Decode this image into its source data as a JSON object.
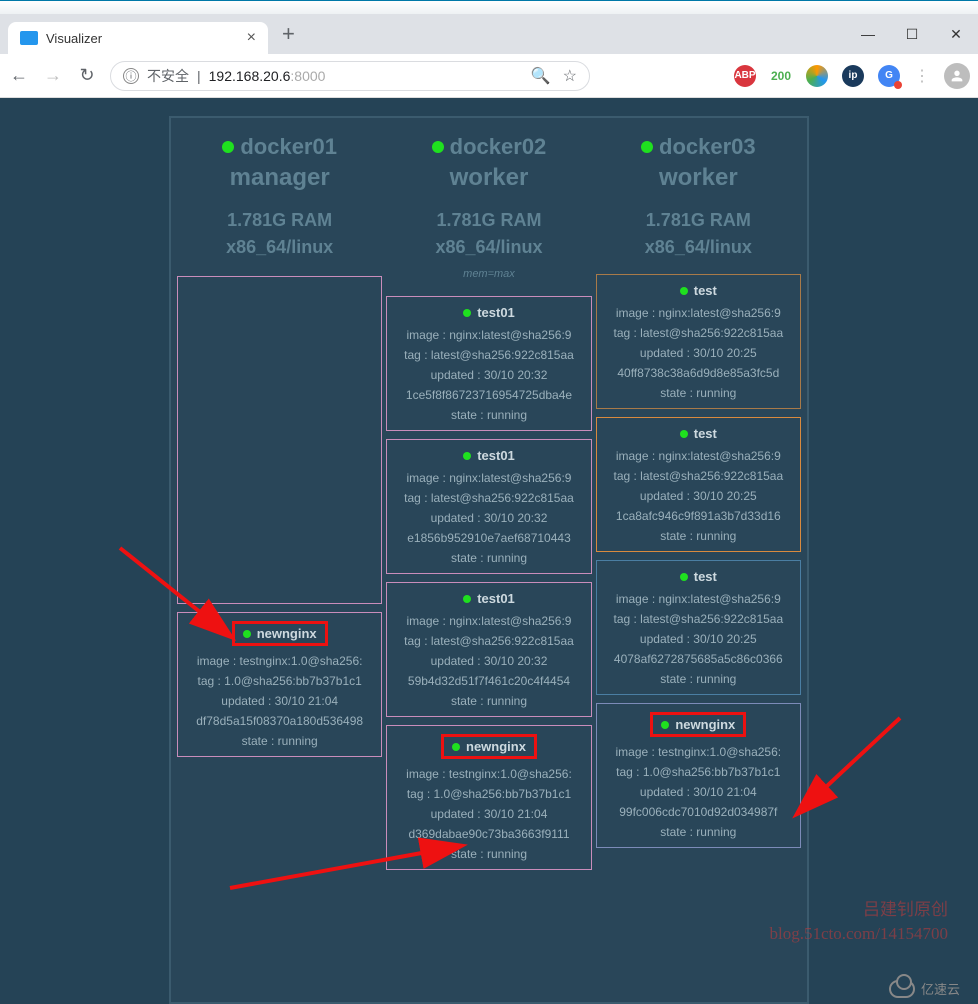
{
  "browser": {
    "tab_title": "Visualizer",
    "tab_close": "×",
    "newtab": "+",
    "win": {
      "min": "—",
      "max": "☐",
      "close": "✕"
    },
    "nav": {
      "back": "←",
      "fwd": "→",
      "reload": "↻"
    },
    "omnibox": {
      "info": "ⓘ",
      "warning": "不安全",
      "sep": "|",
      "host": "192.168.20.6",
      "port": ":8000",
      "zoom": "🔍",
      "star": "☆"
    },
    "ext": {
      "abp": "ABP",
      "c200": "200",
      "ip": "ip",
      "gt": "G"
    }
  },
  "nodes": [
    {
      "name": "docker01",
      "role": "manager",
      "ram": "1.781G RAM",
      "arch": "x86_64/linux",
      "memmax": "",
      "services": [
        {
          "blank": true,
          "tall": true,
          "cls": "outline-pink"
        },
        {
          "boxed": true,
          "cls": "outline-pink",
          "name": "newnginx",
          "image": "image : testnginx:1.0@sha256:",
          "tag": "tag : 1.0@sha256:bb7b37b1c1",
          "updated": "updated : 30/10 21:04",
          "hash": "df78d5a15f08370a180d536498",
          "state": "state : running"
        }
      ]
    },
    {
      "name": "docker02",
      "role": "worker",
      "ram": "1.781G RAM",
      "arch": "x86_64/linux",
      "memmax": "mem=max",
      "services": [
        {
          "cls": "outline-pink",
          "name": "test01",
          "image": "image : nginx:latest@sha256:9",
          "tag": "tag : latest@sha256:922c815aa",
          "updated": "updated : 30/10 20:32",
          "hash": "1ce5f8f86723716954725dba4e",
          "state": "state : running"
        },
        {
          "cls": "outline-pink",
          "name": "test01",
          "image": "image : nginx:latest@sha256:9",
          "tag": "tag : latest@sha256:922c815aa",
          "updated": "updated : 30/10 20:32",
          "hash": "e1856b952910e7aef68710443",
          "state": "state : running"
        },
        {
          "cls": "outline-pink",
          "name": "test01",
          "image": "image : nginx:latest@sha256:9",
          "tag": "tag : latest@sha256:922c815aa",
          "updated": "updated : 30/10 20:32",
          "hash": "59b4d32d51f7f461c20c4f4454",
          "state": "state : running"
        },
        {
          "boxed": true,
          "cls": "outline-pink",
          "name": "newnginx",
          "image": "image : testnginx:1.0@sha256:",
          "tag": "tag : 1.0@sha256:bb7b37b1c1",
          "updated": "updated : 30/10 21:04",
          "hash": "d369dabae90c73ba3663f9111",
          "state": "state : running"
        }
      ]
    },
    {
      "name": "docker03",
      "role": "worker",
      "ram": "1.781G RAM",
      "arch": "x86_64/linux",
      "memmax": "",
      "services": [
        {
          "cls": "outline-brown",
          "name": "test",
          "image": "image : nginx:latest@sha256:9",
          "tag": "tag : latest@sha256:922c815aa",
          "updated": "updated : 30/10 20:25",
          "hash": "40ff8738c38a6d9d8e85a3fc5d",
          "state": "state : running"
        },
        {
          "cls": "outline-orange",
          "name": "test",
          "image": "image : nginx:latest@sha256:9",
          "tag": "tag : latest@sha256:922c815aa",
          "updated": "updated : 30/10 20:25",
          "hash": "1ca8afc946c9f891a3b7d33d16",
          "state": "state : running"
        },
        {
          "cls": "outline-blue",
          "name": "test",
          "image": "image : nginx:latest@sha256:9",
          "tag": "tag : latest@sha256:922c815aa",
          "updated": "updated : 30/10 20:25",
          "hash": "4078af6272875685a5c86c0366",
          "state": "state : running"
        },
        {
          "boxed": true,
          "cls": "outline-bluep",
          "name": "newnginx",
          "image": "image : testnginx:1.0@sha256:",
          "tag": "tag : 1.0@sha256:bb7b37b1c1",
          "updated": "updated : 30/10 21:04",
          "hash": "99fc006cdc7010d92d034987f",
          "state": "state : running"
        }
      ]
    }
  ],
  "watermark": {
    "l1": "吕建钊原创",
    "l2": "blog.51cto.com/14154700",
    "brand": "亿速云"
  }
}
